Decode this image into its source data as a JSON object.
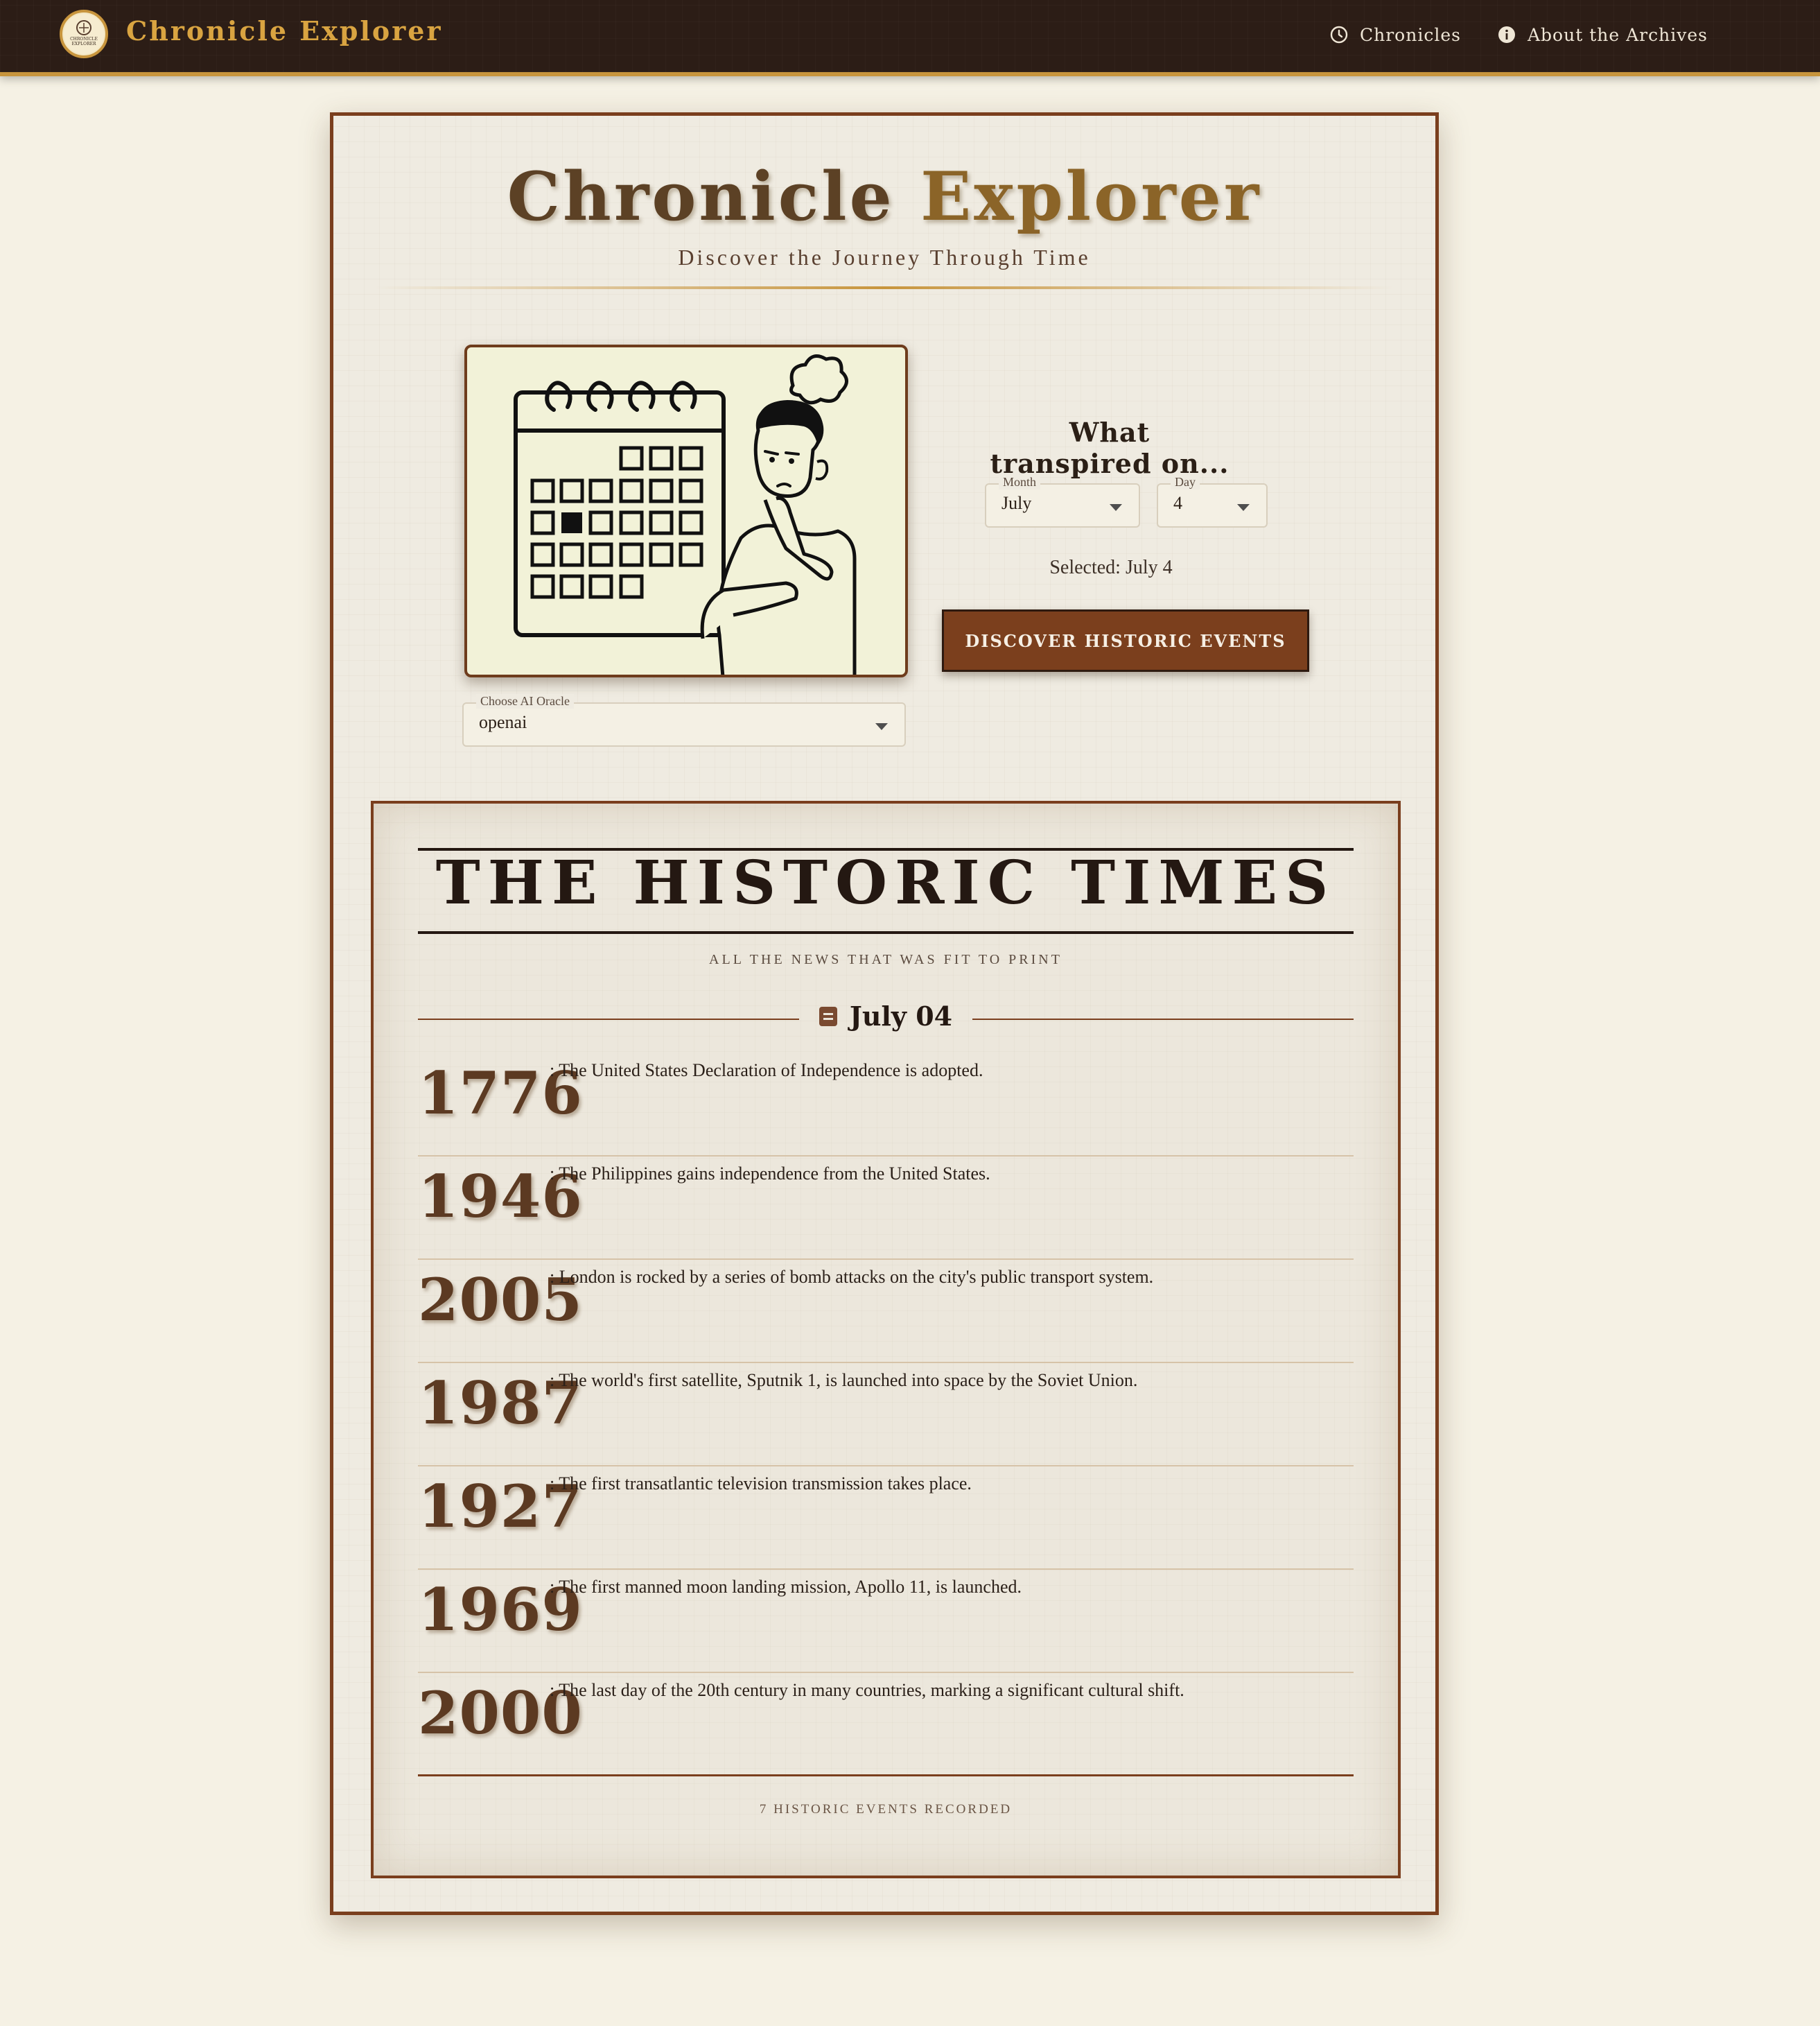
{
  "nav": {
    "brand": "Chronicle Explorer",
    "logo_text_top": "CHRONICLE",
    "logo_text_bottom": "EXPLORER",
    "links": [
      {
        "label": "Chronicles",
        "icon": "clock-icon"
      },
      {
        "label": "About the Archives",
        "icon": "info-icon"
      }
    ]
  },
  "hero": {
    "title_part1": "Chronicle",
    "title_part2": "Explorer",
    "subtitle": "Discover the Journey Through Time"
  },
  "form": {
    "question": "What transpired on...",
    "month_label": "Month",
    "month_value": "July",
    "day_label": "Day",
    "day_value": "4",
    "selected_text": "Selected: July 4",
    "oracle_label": "Choose AI Oracle",
    "oracle_value": "openai",
    "discover_button": "DISCOVER HISTORIC EVENTS"
  },
  "newspaper": {
    "masthead": "THE HISTORIC TIMES",
    "tagline": "ALL THE NEWS THAT WAS FIT TO PRINT",
    "date": "July 04",
    "events": [
      {
        "year": "1776",
        "text": ": The United States Declaration of Independence is adopted."
      },
      {
        "year": "1946",
        "text": ": The Philippines gains independence from the United States."
      },
      {
        "year": "2005",
        "text": ": London is rocked by a series of bomb attacks on the city's public transport system."
      },
      {
        "year": "1987",
        "text": ": The world's first satellite, Sputnik 1, is launched into space by the Soviet Union."
      },
      {
        "year": "1927",
        "text": ": The first transatlantic television transmission takes place."
      },
      {
        "year": "1969",
        "text": ": The first manned moon landing mission, Apollo 11, is launched."
      },
      {
        "year": "2000",
        "text": ": The last day of the 20th century in many countries, marking a significant cultural shift."
      }
    ],
    "footer": "7 HISTORIC EVENTS RECORDED"
  },
  "colors": {
    "nav_bg": "#2c1d16",
    "gold": "#c8953d",
    "accent_brown": "#7a3e1d",
    "page_bg": "#f5f1e4"
  }
}
